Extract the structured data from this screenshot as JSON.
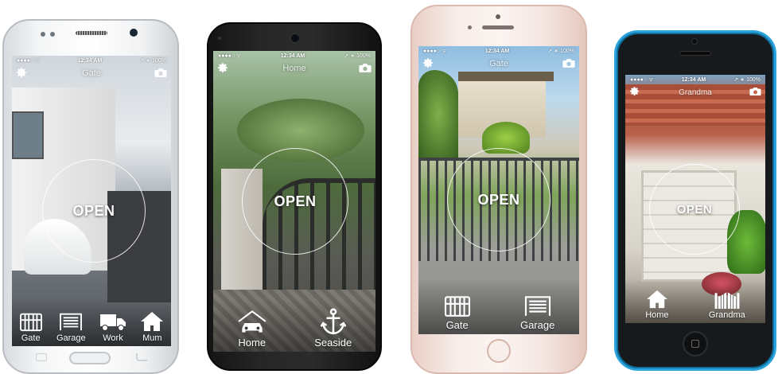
{
  "phones": [
    {
      "status": {
        "carrier": "●●●●○ ᯤ",
        "time": "12:34 AM",
        "battery": "➚ ∗ 100%"
      },
      "title": "Gate",
      "open_label": "OPEN",
      "dock": [
        "Gate",
        "Garage",
        "Work",
        "Mum"
      ]
    },
    {
      "status": {
        "carrier": "●●●●○ ᯤ",
        "time": "12:34 AM",
        "battery": "➚ ∗ 100%"
      },
      "title": "Home",
      "open_label": "OPEN",
      "dock": [
        "Home",
        "Seaside"
      ]
    },
    {
      "status": {
        "carrier": "●●●●○ ᯤ",
        "time": "12:34 AM",
        "battery": "➚ ∗ 100%"
      },
      "title": "Gate",
      "open_label": "OPEN",
      "dock": [
        "Gate",
        "Garage"
      ]
    },
    {
      "status": {
        "carrier": "●●●●○ ᯤ",
        "time": "12:34 AM",
        "battery": "➚ ∗ 100%"
      },
      "title": "Grandma",
      "open_label": "OPEN",
      "dock": [
        "Home",
        "Grandma"
      ]
    }
  ],
  "icons": {
    "settings": "gear-icon",
    "camera": "camera-icon",
    "gate": "gate-icon",
    "garage": "garage-icon",
    "work": "truck-icon",
    "mum": "house-icon",
    "home_car": "car-house-icon",
    "seaside": "anchor-icon",
    "grandma": "double-gate-icon"
  },
  "colors": {
    "android_white": "#f4f5f6",
    "nexus_black": "#1f1f1f",
    "rose_gold": "#f3e3dd",
    "iphone_blue": "#2aa3dc",
    "ring": "#ffffff"
  }
}
